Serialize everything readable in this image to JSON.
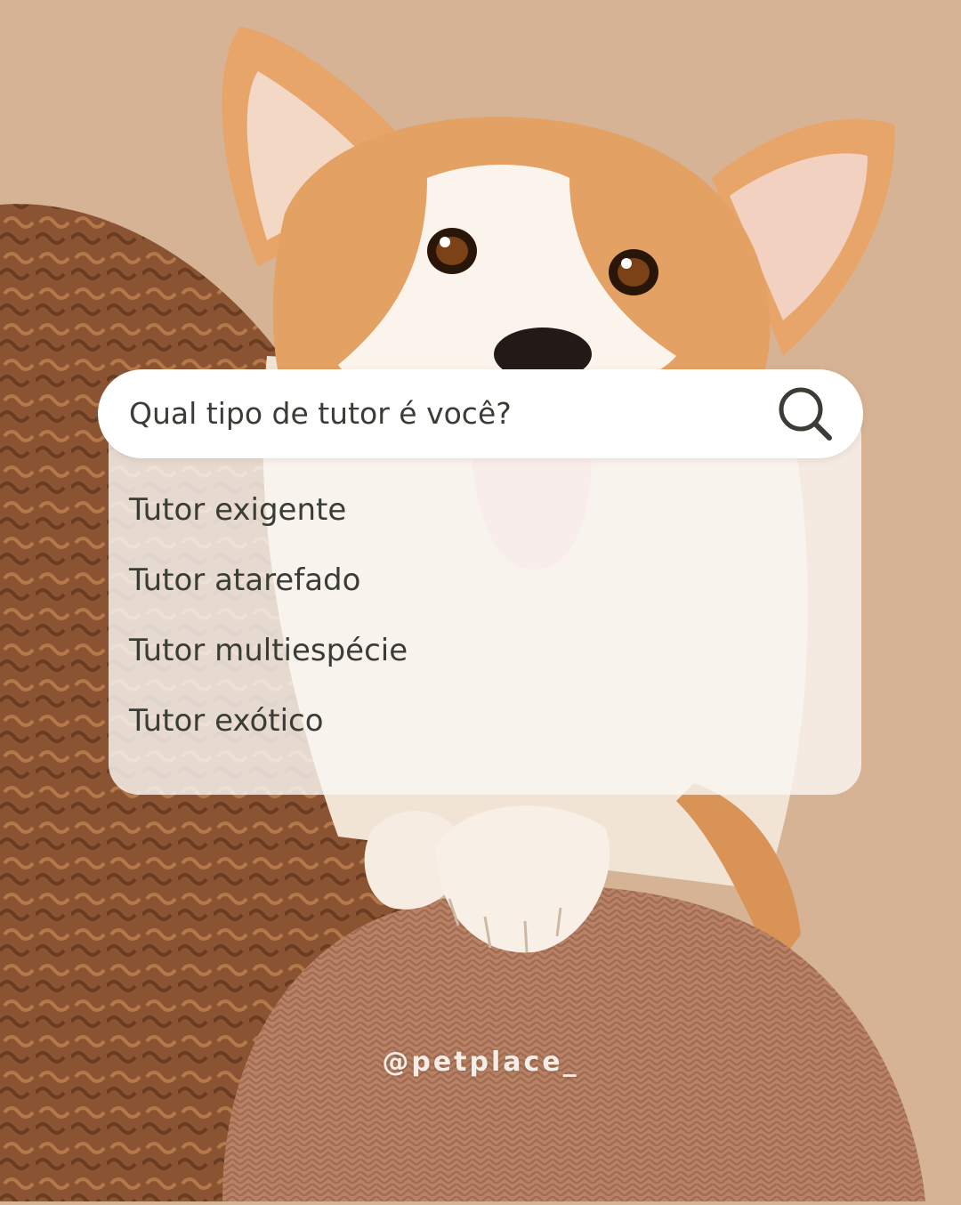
{
  "search": {
    "query": "Qual tipo de tutor é você?",
    "icon": "search-icon"
  },
  "suggestions": [
    {
      "label": "Tutor exigente"
    },
    {
      "label": "Tutor atarefado"
    },
    {
      "label": "Tutor multiespécie"
    },
    {
      "label": "Tutor exótico"
    }
  ],
  "footer": {
    "handle": "@petplace_"
  },
  "colors": {
    "background": "#d5b394",
    "text": "#3a3d35",
    "card": "#faf7f3"
  }
}
